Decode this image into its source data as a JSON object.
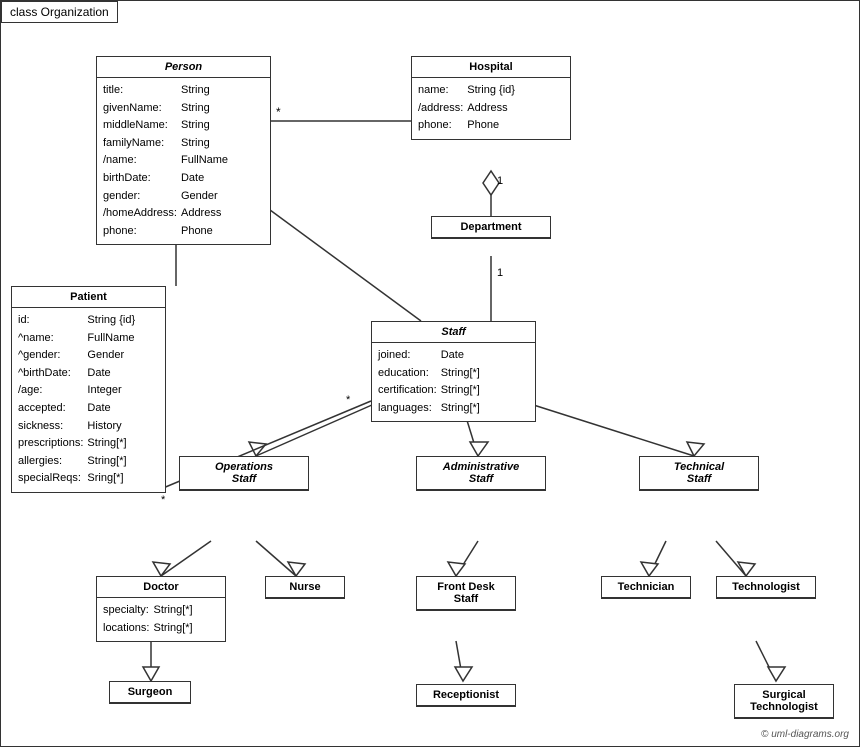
{
  "title": "class Organization",
  "copyright": "© uml-diagrams.org",
  "boxes": {
    "person": {
      "title": "Person",
      "attrs": [
        [
          "title:",
          "String"
        ],
        [
          "givenName:",
          "String"
        ],
        [
          "middleName:",
          "String"
        ],
        [
          "familyName:",
          "String"
        ],
        [
          "/name:",
          "FullName"
        ],
        [
          "birthDate:",
          "Date"
        ],
        [
          "gender:",
          "Gender"
        ],
        [
          "/homeAddress:",
          "Address"
        ],
        [
          "phone:",
          "Phone"
        ]
      ]
    },
    "hospital": {
      "title": "Hospital",
      "attrs": [
        [
          "name:",
          "String {id}"
        ],
        [
          "/address:",
          "Address"
        ],
        [
          "phone:",
          "Phone"
        ]
      ]
    },
    "department": {
      "title": "Department",
      "attrs": []
    },
    "staff": {
      "title": "Staff",
      "attrs": [
        [
          "joined:",
          "Date"
        ],
        [
          "education:",
          "String[*]"
        ],
        [
          "certification:",
          "String[*]"
        ],
        [
          "languages:",
          "String[*]"
        ]
      ]
    },
    "patient": {
      "title": "Patient",
      "attrs": [
        [
          "id:",
          "String {id}"
        ],
        [
          "^name:",
          "FullName"
        ],
        [
          "^gender:",
          "Gender"
        ],
        [
          "^birthDate:",
          "Date"
        ],
        [
          "/age:",
          "Integer"
        ],
        [
          "accepted:",
          "Date"
        ],
        [
          "sickness:",
          "History"
        ],
        [
          "prescriptions:",
          "String[*]"
        ],
        [
          "allergies:",
          "String[*]"
        ],
        [
          "specialReqs:",
          "Sring[*]"
        ]
      ]
    },
    "operations_staff": {
      "title": "Operations\nStaff",
      "italic": true
    },
    "administrative_staff": {
      "title": "Administrative\nStaff",
      "italic": true
    },
    "technical_staff": {
      "title": "Technical\nStaff",
      "italic": true
    },
    "doctor": {
      "title": "Doctor",
      "attrs": [
        [
          "specialty:",
          "String[*]"
        ],
        [
          "locations:",
          "String[*]"
        ]
      ]
    },
    "nurse": {
      "title": "Nurse",
      "attrs": []
    },
    "front_desk_staff": {
      "title": "Front Desk\nStaff",
      "attrs": []
    },
    "technician": {
      "title": "Technician",
      "attrs": []
    },
    "technologist": {
      "title": "Technologist",
      "attrs": []
    },
    "surgeon": {
      "title": "Surgeon",
      "attrs": []
    },
    "receptionist": {
      "title": "Receptionist",
      "attrs": []
    },
    "surgical_technologist": {
      "title": "Surgical\nTechnologist",
      "attrs": []
    }
  }
}
